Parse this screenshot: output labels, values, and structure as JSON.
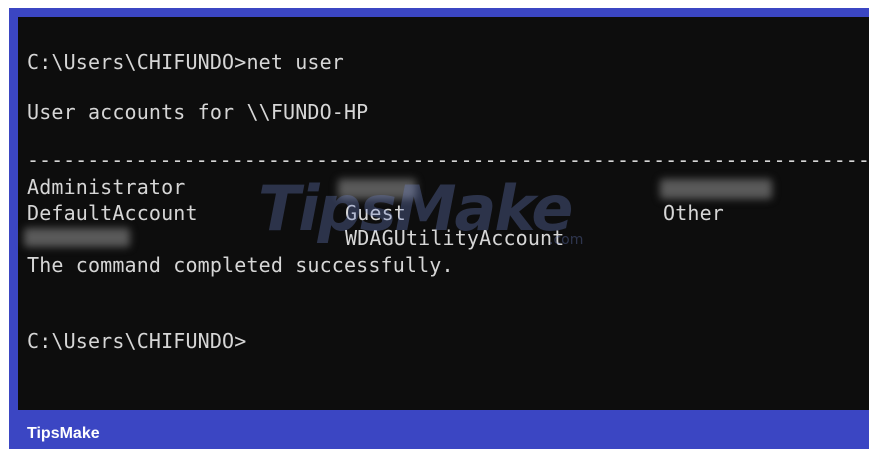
{
  "terminal": {
    "command_line": "C:\\Users\\CHIFUNDO>net user",
    "accounts_header": "User accounts for \\\\FUNDO-HP",
    "separator": "-------------------------------------------------------------------------------",
    "accounts": [
      [
        "Administrator",
        "",
        ""
      ],
      [
        "DefaultAccount",
        "Guest",
        "Other"
      ],
      [
        "",
        "WDAGUtilityAccount",
        ""
      ]
    ],
    "completion_message": "The command completed successfully.",
    "prompt": "C:\\Users\\CHIFUNDO>"
  },
  "watermark": {
    "text": "TipsMake",
    "suffix": ".com"
  },
  "footer": {
    "brand": "TipsMake"
  },
  "colors": {
    "frame": "#3b46c3",
    "terminal_bg": "#0d0d0d",
    "text": "#d6d6d6"
  }
}
